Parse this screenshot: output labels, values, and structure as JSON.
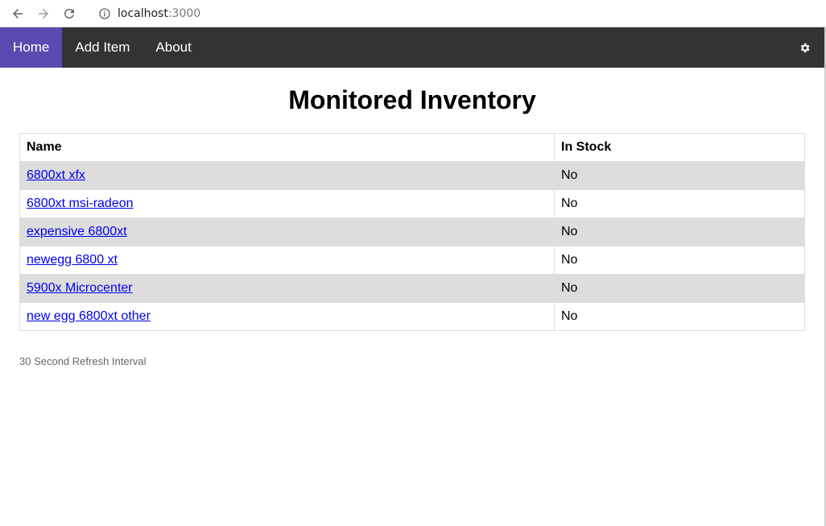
{
  "browser": {
    "url_host": "localhost",
    "url_port": ":3000"
  },
  "nav": {
    "items": [
      {
        "label": "Home",
        "active": true
      },
      {
        "label": "Add Item",
        "active": false
      },
      {
        "label": "About",
        "active": false
      }
    ],
    "settings_icon": "gear-icon",
    "colors": {
      "bar": "#333333",
      "active": "#5b4bb0"
    }
  },
  "page": {
    "title": "Monitored Inventory",
    "table": {
      "headers": [
        "Name",
        "In Stock"
      ],
      "rows": [
        {
          "name": "6800xt xfx",
          "in_stock": "No"
        },
        {
          "name": "6800xt msi-radeon",
          "in_stock": "No"
        },
        {
          "name": "expensive 6800xt",
          "in_stock": "No"
        },
        {
          "name": "newegg 6800 xt",
          "in_stock": "No"
        },
        {
          "name": "5900x Microcenter",
          "in_stock": "No"
        },
        {
          "name": "new egg 6800xt other",
          "in_stock": "No"
        }
      ]
    },
    "footer_note": "30 Second Refresh Interval"
  }
}
